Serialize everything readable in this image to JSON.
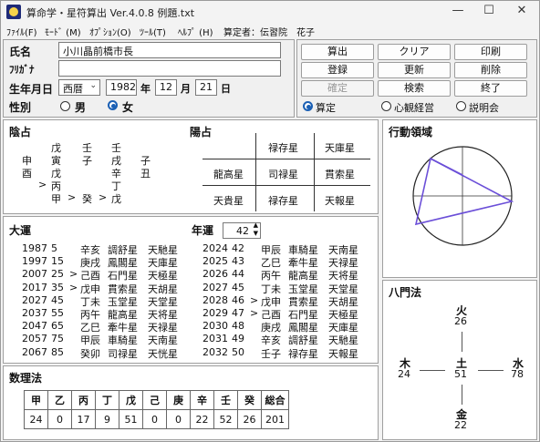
{
  "window": {
    "title": "算命学・星符算出  Ver.4.0.8    例題.txt",
    "minimize": "—",
    "maximize": "☐",
    "close": "✕"
  },
  "menu": [
    "ﾌｧｲﾙ(F)",
    "ﾓｰﾄﾞ (M)",
    "ｵﾌﾟｼｮﾝ(O)",
    "ﾂｰﾙ(T)",
    "ﾍﾙﾌﾟ (H)",
    "算定者：伝習院　花子"
  ],
  "form": {
    "name_label": "氏名",
    "name_value": "小川晶前橋市長",
    "kana_label": "ﾌﾘｶﾞﾅ",
    "kana_value": "",
    "birth_label": "生年月日",
    "era": "西暦",
    "year": "1982",
    "year_unit": "年",
    "month": "12",
    "month_unit": "月",
    "day": "21",
    "day_unit": "日",
    "sex_label": "性別",
    "sex_male": "男",
    "sex_female": "女"
  },
  "buttons": {
    "calc": "算出",
    "clear": "クリア",
    "print": "印刷",
    "register": "登録",
    "update": "更新",
    "delete": "削除",
    "confirm": "確定",
    "search": "検索",
    "exit": "終了"
  },
  "modes": [
    "算定",
    "心観経営",
    "説明会"
  ],
  "insen": {
    "title": "陰占",
    "col_gan_top": [
      "戊",
      "壬",
      "壬"
    ],
    "row2": [
      "申",
      "寅",
      "子",
      "戌",
      "子"
    ],
    "row3": [
      "酉",
      "戊",
      "",
      "辛",
      "丑"
    ],
    "row4": [
      "",
      "丙",
      "",
      "丁",
      ""
    ],
    "row5": [
      "",
      "甲",
      "癸",
      "戊",
      ""
    ],
    "arrow": ">"
  },
  "yosen": {
    "title": "陽占",
    "cells": [
      "禄存星",
      "天庫星",
      "龍高星",
      "司禄星",
      "貫索星",
      "天貴星",
      "禄存星",
      "天報星"
    ]
  },
  "koudou": {
    "title": "行動領域"
  },
  "taiun": {
    "title": "大運",
    "rows": [
      [
        "1987",
        "5",
        "",
        "辛亥",
        "調舒星",
        "天馳星"
      ],
      [
        "1997",
        "15",
        "",
        "庚戌",
        "鳳閣星",
        "天庫星"
      ],
      [
        "2007",
        "25",
        ">",
        "己酉",
        "石門星",
        "天極星"
      ],
      [
        "2017",
        "35",
        ">",
        "戊申",
        "貫索星",
        "天胡星"
      ],
      [
        "2027",
        "45",
        "",
        "丁未",
        "玉堂星",
        "天堂星"
      ],
      [
        "2037",
        "55",
        "",
        "丙午",
        "龍高星",
        "天将星"
      ],
      [
        "2047",
        "65",
        "",
        "乙巳",
        "牽牛星",
        "天禄星"
      ],
      [
        "2057",
        "75",
        "",
        "甲辰",
        "車騎星",
        "天南星"
      ],
      [
        "2067",
        "85",
        "",
        "癸卯",
        "司禄星",
        "天恍星"
      ]
    ]
  },
  "nenun": {
    "title": "年運",
    "age": "42",
    "rows": [
      [
        "2024",
        "42",
        "",
        "甲辰",
        "車騎星",
        "天南星"
      ],
      [
        "2025",
        "43",
        "",
        "乙巳",
        "牽牛星",
        "天禄星"
      ],
      [
        "2026",
        "44",
        "",
        "丙午",
        "龍高星",
        "天将星"
      ],
      [
        "2027",
        "45",
        "",
        "丁未",
        "玉堂星",
        "天堂星"
      ],
      [
        "2028",
        "46",
        ">",
        "戊申",
        "貫索星",
        "天胡星"
      ],
      [
        "2029",
        "47",
        ">",
        "己酉",
        "石門星",
        "天極星"
      ],
      [
        "2030",
        "48",
        "",
        "庚戌",
        "鳳閣星",
        "天庫星"
      ],
      [
        "2031",
        "49",
        "",
        "辛亥",
        "調舒星",
        "天馳星"
      ],
      [
        "2032",
        "50",
        "",
        "壬子",
        "禄存星",
        "天報星"
      ]
    ]
  },
  "hachimon": {
    "title": "八門法",
    "fire": {
      "label": "火",
      "value": "26"
    },
    "wood": {
      "label": "木",
      "value": "24"
    },
    "earth": {
      "label": "土",
      "value": "51"
    },
    "water": {
      "label": "水",
      "value": "78"
    },
    "metal": {
      "label": "金",
      "value": "22"
    }
  },
  "suuri": {
    "title": "数理法",
    "headers": [
      "甲",
      "乙",
      "丙",
      "丁",
      "戊",
      "己",
      "庚",
      "辛",
      "壬",
      "癸",
      "総合"
    ],
    "values": [
      "24",
      "0",
      "17",
      "9",
      "51",
      "0",
      "0",
      "22",
      "52",
      "26",
      "201"
    ]
  }
}
